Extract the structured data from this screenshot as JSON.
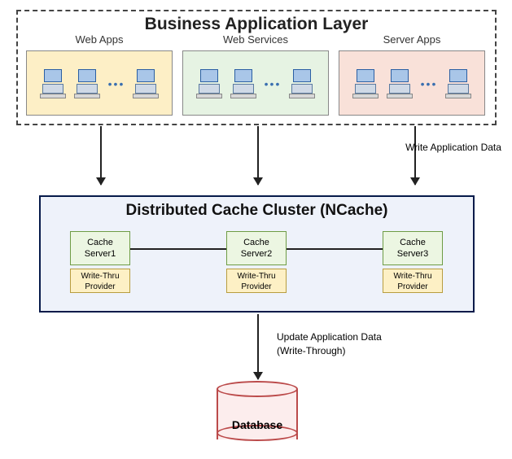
{
  "businessLayer": {
    "title": "Business Application Layer",
    "groups": [
      {
        "label": "Web Apps"
      },
      {
        "label": "Web Services"
      },
      {
        "label": "Server Apps"
      }
    ]
  },
  "arrow1Label": "Write Application Data",
  "cacheCluster": {
    "title": "Distributed Cache Cluster (NCache)",
    "servers": [
      {
        "name": "Cache Server1",
        "provider": "Write-Thru Provider"
      },
      {
        "name": "Cache Server2",
        "provider": "Write-Thru Provider"
      },
      {
        "name": "Cache Server3",
        "provider": "Write-Thru Provider"
      }
    ]
  },
  "arrow2Label": "Update Application Data (Write-Through)",
  "database": {
    "label": "Database"
  }
}
